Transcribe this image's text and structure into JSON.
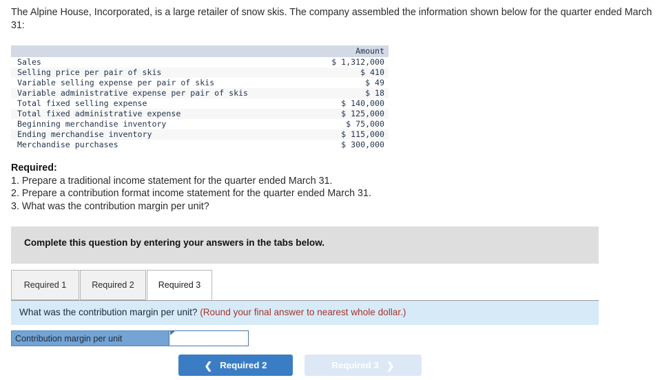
{
  "intro": {
    "text": "The Alpine House, Incorporated, is a large retailer of snow skis. The company assembled the information shown below for the quarter ended March 31:"
  },
  "table": {
    "columns": [
      "",
      "Amount"
    ],
    "rows": [
      {
        "label": "Sales",
        "amount": "$ 1,312,000"
      },
      {
        "label": "Selling price per pair of skis",
        "amount": "$ 410"
      },
      {
        "label": "Variable selling expense per pair of skis",
        "amount": "$ 49"
      },
      {
        "label": "Variable administrative expense per pair of skis",
        "amount": "$ 18"
      },
      {
        "label": "Total fixed selling expense",
        "amount": "$ 140,000"
      },
      {
        "label": "Total fixed administrative expense",
        "amount": "$ 125,000"
      },
      {
        "label": "Beginning merchandise inventory",
        "amount": "$ 75,000"
      },
      {
        "label": "Ending merchandise inventory",
        "amount": "$ 115,000"
      },
      {
        "label": "Merchandise purchases",
        "amount": "$ 300,000"
      }
    ]
  },
  "required": {
    "title": "Required:",
    "items": [
      "1. Prepare a traditional income statement for the quarter ended March 31.",
      "2. Prepare a contribution format income statement for the quarter ended March 31.",
      "3. What was the contribution margin per unit?"
    ]
  },
  "instruction": {
    "text": "Complete this question by entering your answers in the tabs below."
  },
  "tabs": [
    {
      "label": "Required 1",
      "active": false
    },
    {
      "label": "Required 2",
      "active": false
    },
    {
      "label": "Required 3",
      "active": true
    }
  ],
  "question": {
    "prompt": "What was the contribution margin per unit? ",
    "hint": "(Round your final answer to nearest whole dollar.)"
  },
  "answer": {
    "label": "Contribution margin per unit",
    "value": "",
    "placeholder": ""
  },
  "nav": {
    "prev_label": "Required 2",
    "prev_icon": "chevron-left-icon",
    "next_label": "Required 3",
    "next_icon": "chevron-right-icon"
  },
  "colors": {
    "accent_blue": "#3b7dc4",
    "disabled_blue": "#dce8f5",
    "question_band": "#d7eaf8",
    "instruction_band": "#dedede",
    "table_header": "#d3dae6",
    "answer_label": "#74a4d4",
    "hint_red": "#a6342a"
  }
}
